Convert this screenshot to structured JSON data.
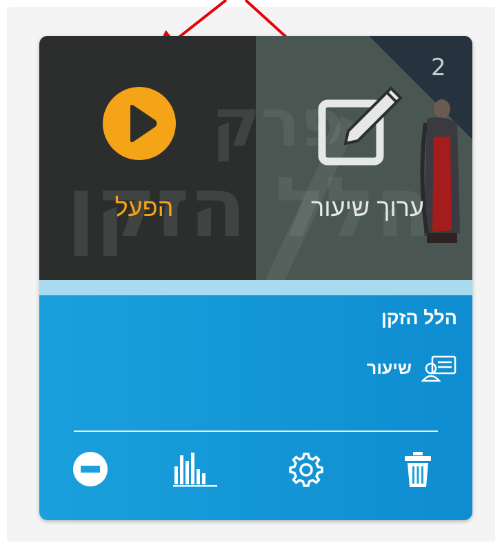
{
  "card": {
    "badge_number": "2",
    "play_label": "הפעל",
    "edit_label": "ערוך שיעור",
    "lesson_title": "הלל הזקן",
    "lesson_type": "שיעור",
    "cover_watermark_lines": [
      "פרק",
      "הלל הזקן"
    ]
  },
  "toolbar": {
    "buttons": [
      "remove-icon",
      "stats-icon",
      "gear-icon",
      "trash-icon"
    ]
  },
  "colors": {
    "play_accent": "#f5a418",
    "card_blue": "#1aa0dc",
    "strip": "#a8dbef",
    "cover_dark": "#2b2e2c",
    "arrow_red": "#e8000b"
  }
}
